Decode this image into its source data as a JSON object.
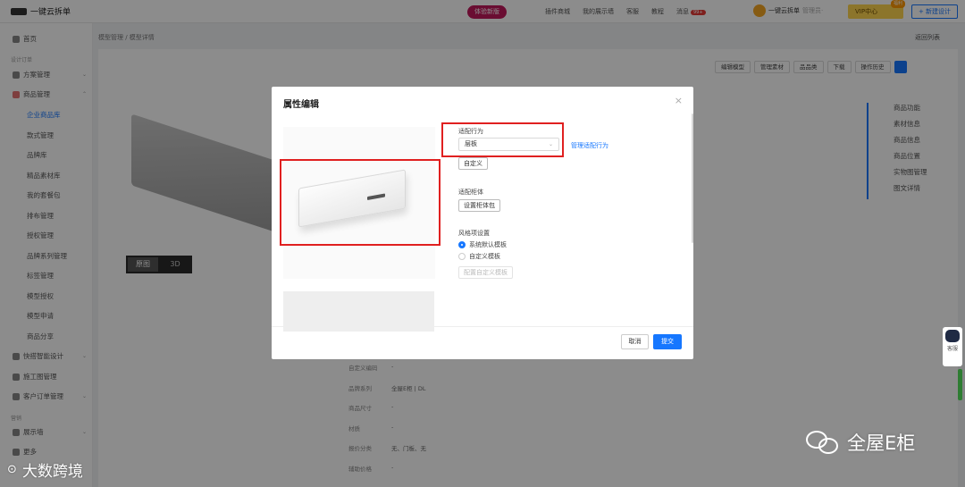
{
  "header": {
    "app_name": "一键云拆单",
    "promo": "体验新版",
    "nav": [
      "插件商城",
      "我的展示墙",
      "客服",
      "教程"
    ],
    "messages_label": "消息",
    "messages_badge": "99+",
    "user_name": "一键云拆单",
    "user_status": "管理员·",
    "vip_label": "VIP中心",
    "vip_tag": "福利",
    "new_design": "+ 新建设计"
  },
  "sidebar": {
    "home": "首页",
    "group1": "设计订单",
    "scheme": "方案管理",
    "goods": "商品管理",
    "sub_items": [
      "企业商品库",
      "款式管理",
      "品牌库",
      "精品素材库",
      "我的套餐包",
      "排布管理",
      "授权管理",
      "品牌系列管理",
      "标签管理",
      "模型授权",
      "模型申请",
      "商品分享"
    ],
    "quick_design": "快搭智能设计",
    "construction": "施工图管理",
    "customer_orders": "客户订单管理",
    "group2": "营销",
    "showroom": "展示墙",
    "bottom_item": "更多"
  },
  "breadcrumb": {
    "path": "模型管理 / 模型详情",
    "back": "返回列表"
  },
  "toolbar": [
    "编辑模型",
    "管理素材",
    "品品类",
    "下载",
    "操作历史"
  ],
  "anchor_nav": [
    "商品功能",
    "素材信息",
    "商品信息",
    "商品位置",
    "实物图管理",
    "图文详情"
  ],
  "view_toggle": {
    "image": "原图",
    "three_d": "3D"
  },
  "attributes": [
    {
      "k": "自定义编码",
      "v": "-"
    },
    {
      "k": "品牌系列",
      "v": "全屋E柜 | DL"
    },
    {
      "k": "商品尺寸",
      "v": "-"
    },
    {
      "k": "材质",
      "v": "-"
    },
    {
      "k": "报价分类",
      "v": "无、门板、无"
    },
    {
      "k": "辅助价格",
      "v": "-"
    }
  ],
  "modal": {
    "title": "属性编辑",
    "close": "×",
    "behavior_label": "适配行为",
    "behavior_value": "层板",
    "manage_behavior": "管理适配行为",
    "custom": "自定义",
    "cabinet_label": "适配柜体",
    "cabinet_button": "设置柜体包",
    "style_label": "风格项设置",
    "radio_default": "系统默认模板",
    "radio_custom": "自定义模板",
    "config_button": "配置自定义模板",
    "cancel": "取消",
    "submit": "提交"
  },
  "service_widget": {
    "label": "客服"
  },
  "watermarks": {
    "left_logo": "⊙",
    "left_text": "大数跨境",
    "right_text": "全屋E柜"
  },
  "colors": {
    "primary": "#1677ff",
    "highlight": "#e02020",
    "overlay": "rgba(0,0,0,0.45)"
  }
}
